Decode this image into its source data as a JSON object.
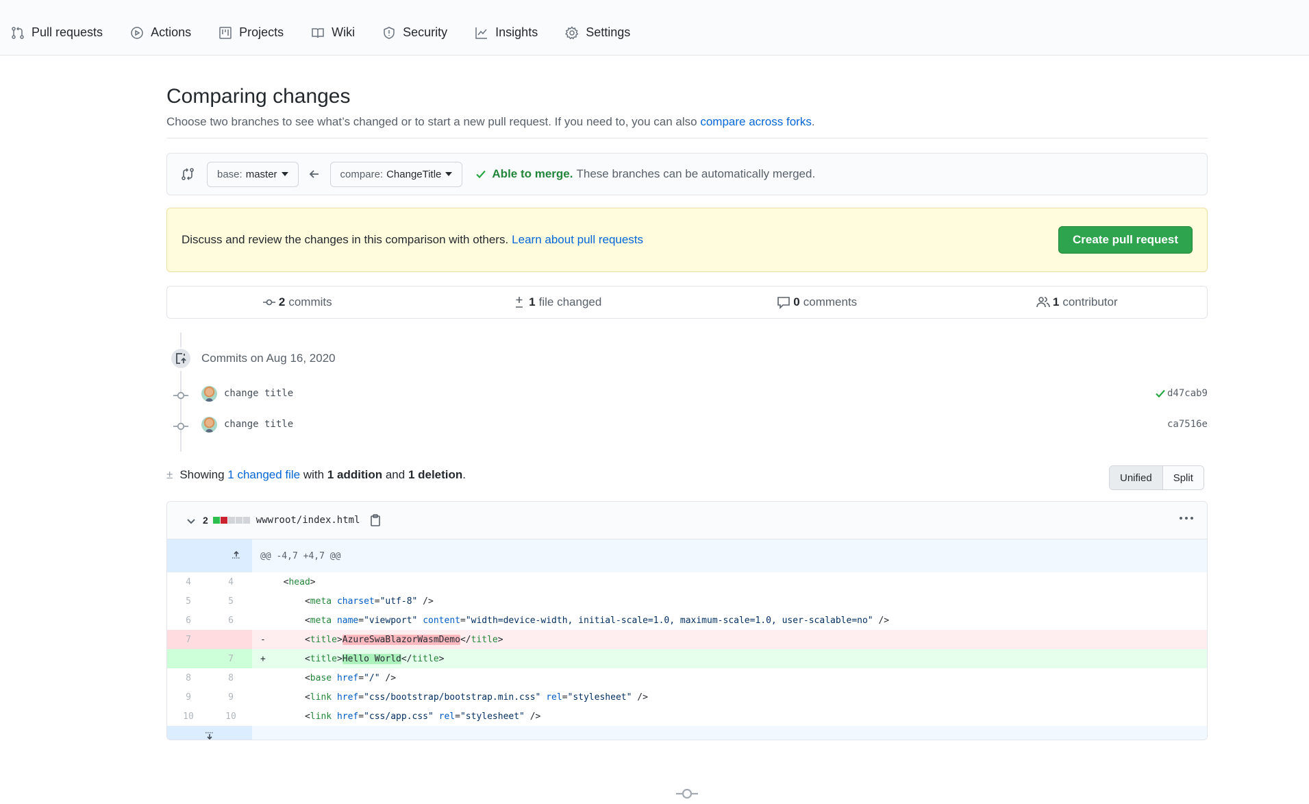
{
  "nav": {
    "tabs": [
      {
        "label": "Pull requests",
        "icon": "git-pull-request-icon"
      },
      {
        "label": "Actions",
        "icon": "play-icon"
      },
      {
        "label": "Projects",
        "icon": "project-icon"
      },
      {
        "label": "Wiki",
        "icon": "book-icon"
      },
      {
        "label": "Security",
        "icon": "shield-icon"
      },
      {
        "label": "Insights",
        "icon": "graph-icon"
      },
      {
        "label": "Settings",
        "icon": "gear-icon"
      }
    ]
  },
  "header": {
    "title": "Comparing changes",
    "subtitle": "Choose two branches to see what’s changed or to start a new pull request. If you need to, you can also ",
    "subtitle_link": "compare across forks",
    "subtitle_end": "."
  },
  "range": {
    "base_prefix": "base:",
    "base_branch": "master",
    "compare_prefix": "compare:",
    "compare_branch": "ChangeTitle",
    "merge_status": "Able to merge.",
    "merge_detail": "These branches can be automatically merged."
  },
  "flash": {
    "text": "Discuss and review the changes in this comparison with others.",
    "link": "Learn about pull requests",
    "button": "Create pull request"
  },
  "summary": {
    "commits_count": "2",
    "commits_label": "commits",
    "files_count": "1",
    "files_label": "file changed",
    "comments_count": "0",
    "comments_label": "comments",
    "contributors_count": "1",
    "contributors_label": "contributor"
  },
  "commits": {
    "group_title": "Commits on Aug 16, 2020",
    "items": [
      {
        "message": "change title",
        "sha": "d47cab9",
        "verified_check": true
      },
      {
        "message": "change title",
        "sha": "ca7516e",
        "verified_check": false
      }
    ]
  },
  "toc": {
    "showing": "Showing ",
    "changed_link": "1 changed file",
    "with": " with ",
    "additions": "1 addition",
    "and": " and ",
    "deletions": "1 deletion",
    "end": "."
  },
  "view_toggle": {
    "unified": "Unified",
    "split": "Split",
    "selected": "Unified"
  },
  "file": {
    "changes": "2",
    "path": "wwwroot/index.html",
    "diffstat": [
      "add",
      "del",
      "neutral",
      "neutral",
      "neutral"
    ],
    "colors": {
      "add": "#2cbe4e",
      "del": "#cb2431",
      "neutral": "#d1d5da"
    },
    "hunk_header": "@@ -4,7 +4,7 @@"
  },
  "diff_lines": [
    {
      "old": "4",
      "new": "4",
      "type": "ctx",
      "sign": "",
      "code": "  <head>"
    },
    {
      "old": "5",
      "new": "5",
      "type": "ctx",
      "sign": "",
      "code": "      <meta charset=\"utf-8\" />"
    },
    {
      "old": "6",
      "new": "6",
      "type": "ctx",
      "sign": "",
      "code": "      <meta name=\"viewport\" content=\"width=device-width, initial-scale=1.0, maximum-scale=1.0, user-scalable=no\" />"
    },
    {
      "old": "7",
      "new": "",
      "type": "del",
      "sign": "-",
      "code": "      <title>AzureSwaBlazorWasmDemo</title>",
      "highlight": "AzureSwaBlazorWasmDemo"
    },
    {
      "old": "",
      "new": "7",
      "type": "add",
      "sign": "+",
      "code": "      <title>Hello World</title>",
      "highlight": "Hello World"
    },
    {
      "old": "8",
      "new": "8",
      "type": "ctx",
      "sign": "",
      "code": "      <base href=\"/\" />"
    },
    {
      "old": "9",
      "new": "9",
      "type": "ctx",
      "sign": "",
      "code": "      <link href=\"css/bootstrap/bootstrap.min.css\" rel=\"stylesheet\" />"
    },
    {
      "old": "10",
      "new": "10",
      "type": "ctx",
      "sign": "",
      "code": "      <link href=\"css/app.css\" rel=\"stylesheet\" />"
    }
  ]
}
